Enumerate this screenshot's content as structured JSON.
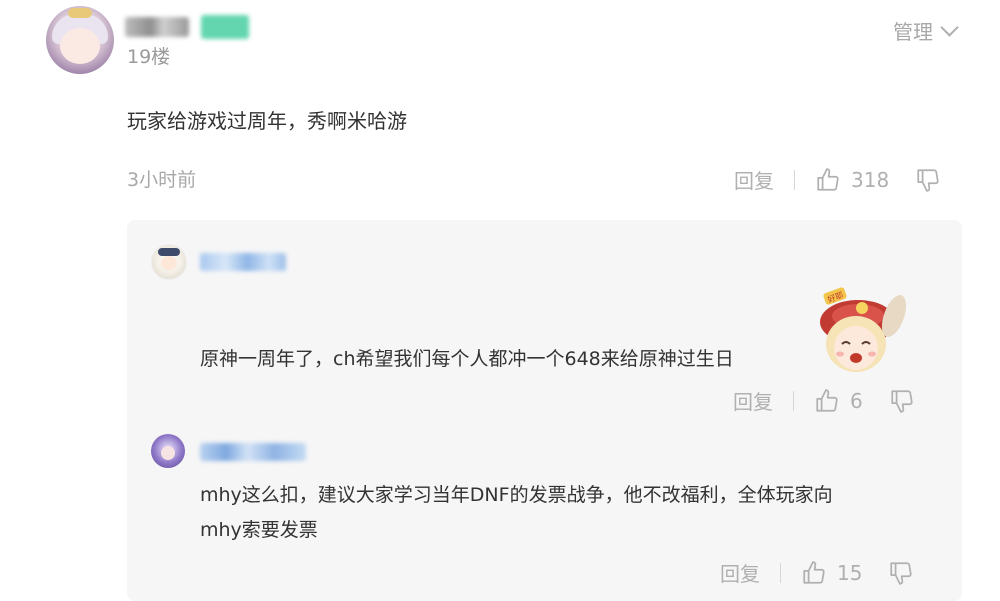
{
  "comment": {
    "floor": "19楼",
    "manage_label": "管理",
    "text": "玩家给游戏过周年，秀啊米哈游",
    "time": "3小时前",
    "reply_label": "回复",
    "likes": "318"
  },
  "replies": [
    {
      "text": "原神一周年了，ch希望我们每个人都冲一个648来给原神过生日",
      "reply_label": "回复",
      "likes": "6",
      "sticker_text": "好耶"
    },
    {
      "text_line1": "mhy这么扣，建议大家学习当年DNF的发票战争，他不改福利，全体玩家向",
      "text_line2": "mhy索要发票",
      "reply_label": "回复",
      "likes": "15"
    }
  ],
  "colors": {
    "reply_bg": "#f6f6f7",
    "muted_text": "#a8a8a8",
    "main_text": "#333333",
    "badge_green": "#63d6b0"
  }
}
